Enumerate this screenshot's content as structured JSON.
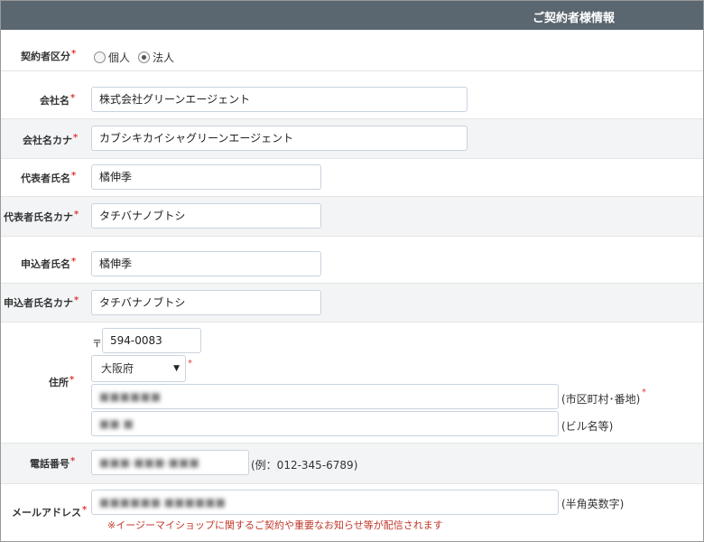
{
  "header": {
    "title": "ご契約者様情報"
  },
  "required_mark": "*",
  "contract_type": {
    "label": "契約者区分",
    "options": [
      {
        "label": "個人",
        "selected": false
      },
      {
        "label": "法人",
        "selected": true
      }
    ]
  },
  "company_name": {
    "label": "会社名",
    "value": "株式会社グリーンエージェント"
  },
  "company_kana": {
    "label": "会社名カナ",
    "value": "カブシキカイシャグリーンエージェント"
  },
  "rep_name": {
    "label": "代表者氏名",
    "value": "橘伸季"
  },
  "rep_kana": {
    "label": "代表者氏名カナ",
    "value": "タチバナノブトシ"
  },
  "applicant_name": {
    "label": "申込者氏名",
    "value": "橘伸季"
  },
  "applicant_kana": {
    "label": "申込者氏名カナ",
    "value": "タチバナノブトシ"
  },
  "address": {
    "label": "住所",
    "postal_mark": "〒",
    "postal_code": "594-0083",
    "prefecture": "大阪府",
    "line1_value": "■■■■■■",
    "line1_hint": "(市区町村･番地)",
    "line2_value": "■■ ■",
    "line2_hint": "(ビル名等)"
  },
  "phone": {
    "label": "電話番号",
    "value": "■■■-■■■-■■■",
    "hint": "(例：012-345-6789)"
  },
  "email": {
    "label": "メールアドレス",
    "value": "■■■■■■ ■■■■■■",
    "hint": "(半角英数字)",
    "note": "※イージーマイショップに関するご契約や重要なお知らせ等が配信されます"
  }
}
